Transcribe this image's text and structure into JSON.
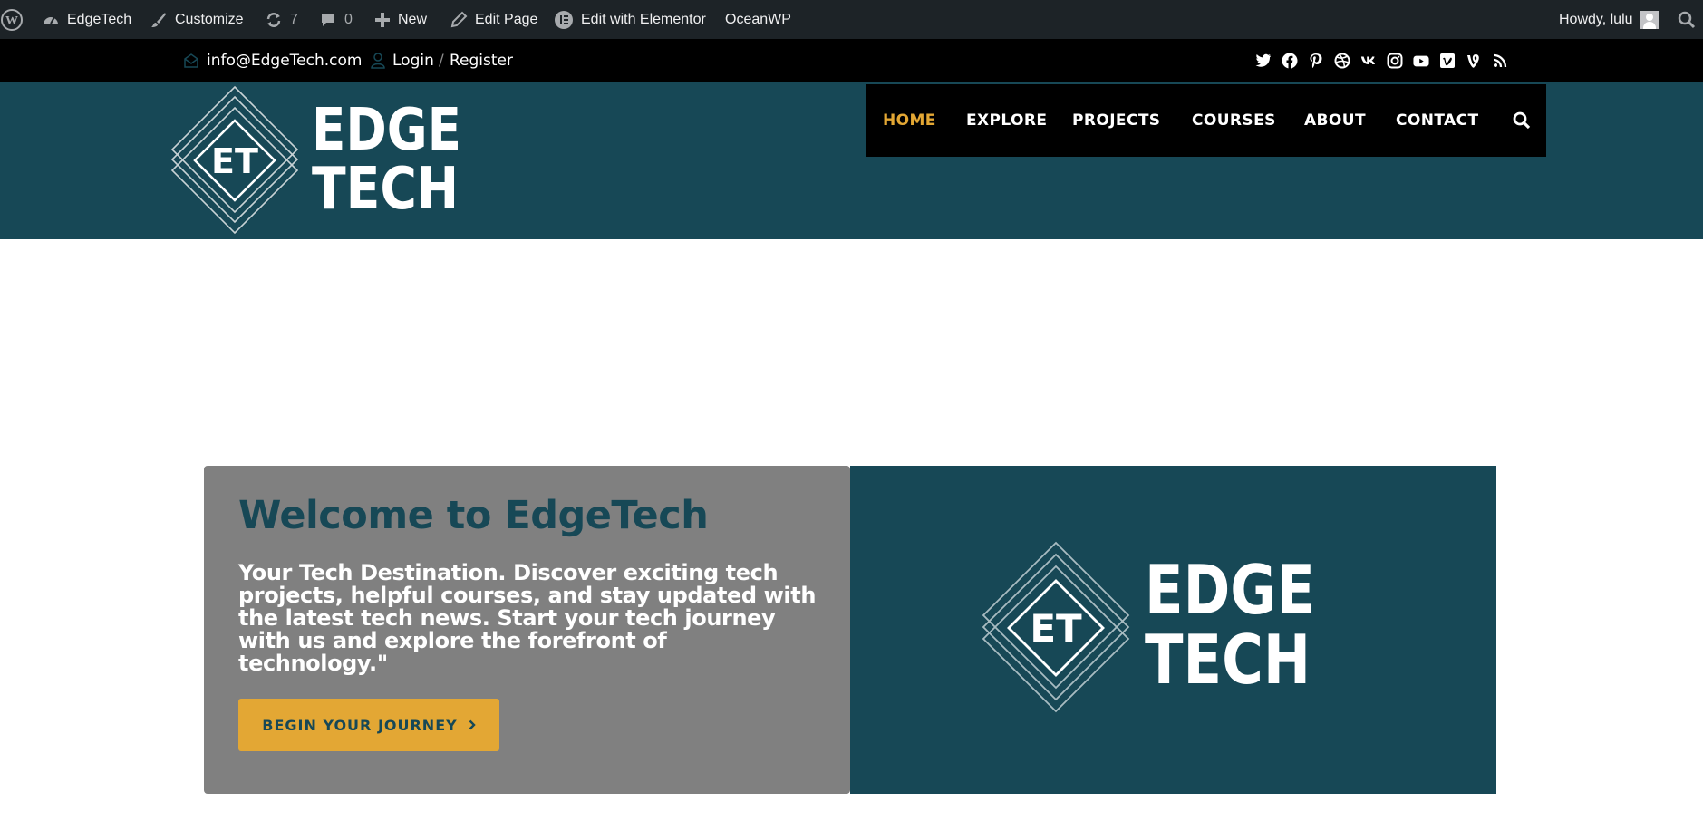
{
  "adminbar": {
    "site_name": "EdgeTech",
    "customize": "Customize",
    "updates_count": "7",
    "comments_count": "0",
    "new_label": "New",
    "edit_page": "Edit Page",
    "edit_elementor": "Edit with Elementor",
    "theme": "OceanWP",
    "howdy": "Howdy, lulu"
  },
  "topbar": {
    "email": "info@EdgeTech.com",
    "login": "Login",
    "separator": "/",
    "register": "Register",
    "social_icons": [
      "twitter-icon",
      "facebook-icon",
      "pinterest-icon",
      "dribbble-icon",
      "vk-icon",
      "instagram-icon",
      "youtube-icon",
      "vimeo-icon",
      "vine-icon",
      "rss-icon"
    ]
  },
  "header": {
    "logo": {
      "monogram": "ET",
      "line1": "EDGE",
      "line2": "TECH"
    },
    "nav": [
      "HOME",
      "EXPLORE",
      "PROJECTS",
      "COURSES",
      "ABOUT",
      "CONTACT"
    ],
    "active_nav": "HOME"
  },
  "hero": {
    "title": "Welcome to EdgeTech",
    "text": "Your Tech Destination. Discover exciting tech projects, helpful courses, and stay updated with the latest tech news. Start your tech journey with us and explore the forefront of technology.\"",
    "button": "BEGIN YOUR JOURNEY",
    "logo": {
      "monogram": "ET",
      "line1": "EDGE",
      "line2": "TECH"
    }
  },
  "colors": {
    "adminbar_bg": "#1d2327",
    "header_bg": "#174856",
    "accent": "#e3a734",
    "card_gray": "#808080"
  }
}
